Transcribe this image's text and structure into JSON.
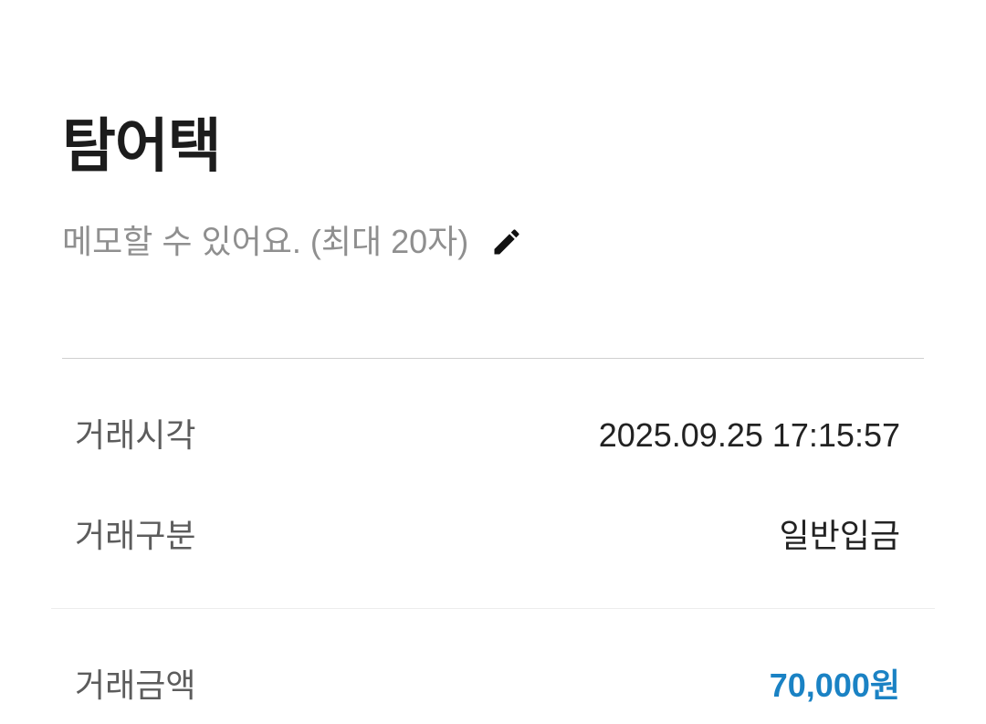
{
  "header": {
    "title": "탐어택"
  },
  "memo": {
    "placeholder": "메모할 수 있어요. (최대 20자)",
    "edit_icon": "pencil-icon"
  },
  "details": {
    "time_label": "거래시각",
    "time_value": "2025.09.25 17:15:57",
    "type_label": "거래구분",
    "type_value": "일반입금",
    "amount_label": "거래금액",
    "amount_value": "70,000원"
  },
  "colors": {
    "amount": "#1a82c4",
    "placeholder": "#8f8f8f",
    "label": "#5c5c5c"
  }
}
